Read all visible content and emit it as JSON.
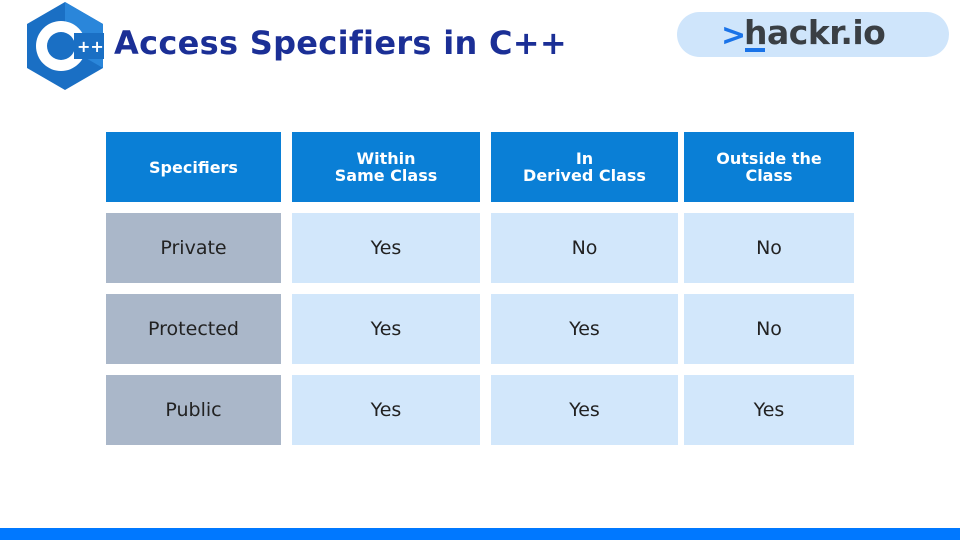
{
  "header": {
    "logo_icon": "cpp-hexagon-logo",
    "logo_text": "C",
    "logo_plus": "++",
    "title": "Access Specifiers in C++"
  },
  "brand": {
    "chevron": ">",
    "name": "hackr.io"
  },
  "table": {
    "columns": [
      "Specifiers",
      "Within\nSame Class",
      "In\nDerived Class",
      "Outside the\nClass"
    ],
    "rows": [
      {
        "specifier": "Private",
        "values": [
          "Yes",
          "No",
          "No"
        ]
      },
      {
        "specifier": "Protected",
        "values": [
          "Yes",
          "Yes",
          "No"
        ]
      },
      {
        "specifier": "Public",
        "values": [
          "Yes",
          "Yes",
          "Yes"
        ]
      }
    ]
  },
  "colors": {
    "title": "#1b2f96",
    "header_bg": "#0a7fd6",
    "specifier_bg": "#aab7c9",
    "value_bg": "#d2e7fb",
    "bottom_bar": "#0078ff"
  }
}
